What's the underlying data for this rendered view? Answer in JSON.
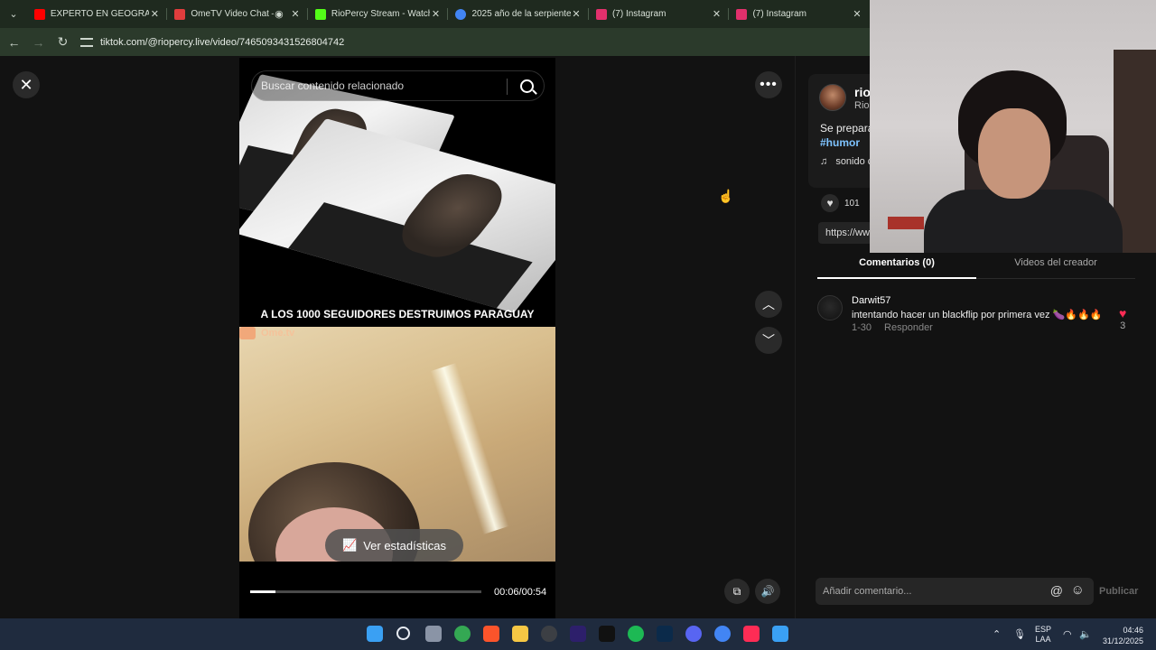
{
  "browser": {
    "tabs": [
      {
        "title": "EXPERTO EN GEOGRAFÍA",
        "favicon_color": "#ff0000"
      },
      {
        "title": "OmeTV Video Chat —",
        "favicon_color": "#e03d3d"
      },
      {
        "title": "RioPercy Stream - Watch L",
        "favicon_color": "#53fc18"
      },
      {
        "title": "2025 año de la serpiente",
        "favicon_color": "#4285f4"
      },
      {
        "title": "(7) Instagram",
        "favicon_color": "#e1306c"
      },
      {
        "title": "(7) Instagram",
        "favicon_color": "#e1306c"
      }
    ],
    "url": "tiktok.com/@riopercy.live/video/7465093431526804742"
  },
  "video": {
    "search_placeholder": "Buscar contenido relacionado",
    "caption_overlay": "A LOS 1000 SEGUIDORES DESTRUIMOS PARAGUAY",
    "ometv_label": "Ome.tv",
    "stats_button": "Ver estadísticas",
    "time": "00:06/00:54",
    "progress_fraction": 0.111
  },
  "panel": {
    "username": "rio",
    "subname": "Rio",
    "description": "Se prepara",
    "hashtag": "#humor",
    "sound": "sonido c",
    "likes": "101",
    "link": "https://ww",
    "tabs": {
      "comments": "Comentarios (0)",
      "creator_videos": "Videos del creador"
    },
    "comment": {
      "user": "Darwit57",
      "text": "intentando hacer un blackflip por primera vez 🍆🔥🔥🔥",
      "date": "1-30",
      "reply": "Responder",
      "likes": "3"
    },
    "comment_input_placeholder": "Añadir comentario...",
    "publish": "Publicar"
  },
  "taskbar": {
    "language": "ESP",
    "layout": "LAA",
    "time": "04:46",
    "date": "31/12/2025"
  }
}
